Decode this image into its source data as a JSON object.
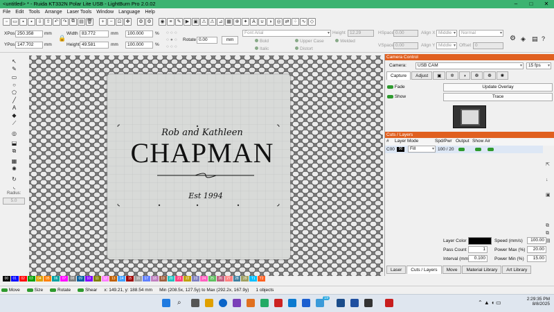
{
  "window": {
    "title": "<untitled> * - Ruida KT332N Polar Lite USB - LightBurn Pro 2.0.02"
  },
  "menu": [
    "File",
    "Edit",
    "Tools",
    "Arrange",
    "Laser Tools",
    "Window",
    "Language",
    "Help"
  ],
  "position": {
    "xpos_label": "XPos",
    "xpos": "250.358",
    "ypos_label": "YPos",
    "ypos": "147.702",
    "unit": "mm",
    "width_label": "Width",
    "width": "83.772",
    "height_label": "Height",
    "height": "49.581",
    "scale_w": "100.000",
    "scale_h": "100.000",
    "pct": "%",
    "rotate_label": "Rotate",
    "rotate": "0.00",
    "rotate_unit": "mm"
  },
  "text_tools": {
    "font_placeholder": "Font Arial",
    "height_label": "Height",
    "height": "12.29",
    "hspace_label": "HSpace",
    "hspace": "0.00",
    "vspace_label": "VSpace",
    "vspace": "0.00",
    "alignx_label": "Align X",
    "alignx": "Middle",
    "aligny_label": "Align Y",
    "aligny": "Middle",
    "mode": "Normal",
    "offset_label": "Offset",
    "offset": "0",
    "bold": "Bold",
    "italic": "Italic",
    "upper": "Upper Case",
    "distort": "Distort",
    "welded": "Welded"
  },
  "left_panel": {
    "radius_label": "Radius:",
    "radius": "5.0"
  },
  "design": {
    "script": "Rob and Kathleen",
    "name": "CHAPMAN",
    "est": "Est 1994"
  },
  "camera": {
    "header": "Camera Control",
    "camera_label": "Camera:",
    "camera": "USB CAM",
    "fps": "15 fps",
    "tab_capture": "Capture",
    "tab_adjust": "Adjust",
    "fade": "Fade",
    "show": "Show",
    "update": "Update Overlay",
    "trace": "Trace"
  },
  "cuts": {
    "header": "Cuts / Layers",
    "cols": [
      "#",
      "Layer",
      "Mode",
      "Spd/Pwr",
      "Output",
      "Show",
      "Air"
    ],
    "row": {
      "num": "C00",
      "layer": "00",
      "mode": "Fill",
      "spdpwr": "100 / 20"
    },
    "layer_color_label": "Layer Color",
    "speed_label": "Speed (mm/s)",
    "speed": "100.00",
    "pass_label": "Pass Count",
    "pass": "1",
    "pmax_label": "Power Max (%)",
    "pmax": "20.00",
    "interval_label": "Interval (mm)",
    "interval": "0.100",
    "pmin_label": "Power Min (%)",
    "pmin": "15.00",
    "tabs": [
      "Laser",
      "Cuts / Layers",
      "Move",
      "Material Library",
      "Art Library"
    ]
  },
  "palette": [
    "00",
    "01",
    "02",
    "03",
    "04",
    "05",
    "06",
    "07",
    "08",
    "09",
    "10",
    "11",
    "12",
    "13",
    "14",
    "15",
    "16",
    "17",
    "18",
    "19",
    "20",
    "21",
    "22",
    "23",
    "24",
    "25",
    "26",
    "27",
    "28",
    "29",
    "T1",
    "T2"
  ],
  "palette_colors": [
    "#000000",
    "#0000ff",
    "#ff0000",
    "#00a000",
    "#e0a000",
    "#ff8000",
    "#00a0a0",
    "#ff00ff",
    "#808080",
    "#0060a0",
    "#8000ff",
    "#808000",
    "#ff80ff",
    "#c06000",
    "#40a0ff",
    "#a00000",
    "#a0a0a0",
    "#6080ff",
    "#c080c0",
    "#a06040",
    "#20c0c0",
    "#ff4080",
    "#c0a000",
    "#8080c0",
    "#ff60c0",
    "#60c060",
    "#c06080",
    "#ff8080",
    "#4080a0",
    "#a0a060",
    "#00c0ff",
    "#ff6020"
  ],
  "status": {
    "move": "Move",
    "size": "Size",
    "rotate": "Rotate",
    "shear": "Shear",
    "coords": "x: 149.21, y: 188.54 mm",
    "bounds": "Min (208.5x, 127.5y) to Max (292.2x, 167.9y)",
    "objects": "1 objects"
  },
  "taskbar": {
    "time": "2:29:35 PM",
    "date": "8/8/2025",
    "badge": "19"
  }
}
